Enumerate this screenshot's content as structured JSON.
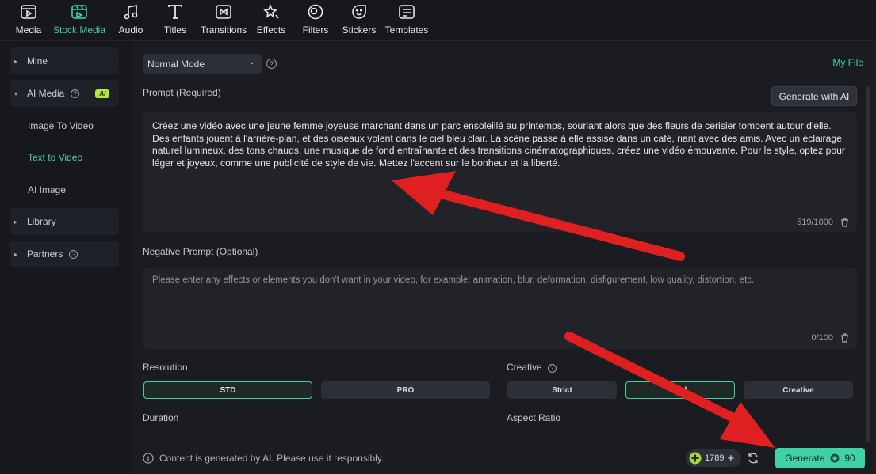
{
  "toolbar": {
    "items": [
      {
        "label": "Media",
        "icon": "media-icon"
      },
      {
        "label": "Stock Media",
        "icon": "stock-media-icon",
        "active": true
      },
      {
        "label": "Audio",
        "icon": "music-note-icon"
      },
      {
        "label": "Titles",
        "icon": "text-t-icon"
      },
      {
        "label": "Transitions",
        "icon": "transitions-icon"
      },
      {
        "label": "Effects",
        "icon": "effects-icon"
      },
      {
        "label": "Filters",
        "icon": "filters-icon"
      },
      {
        "label": "Stickers",
        "icon": "stickers-icon"
      },
      {
        "label": "Templates",
        "icon": "templates-icon"
      }
    ]
  },
  "sidebar": {
    "mine": "Mine",
    "ai_media": "AI Media",
    "ai_badge": "AI",
    "sub_items": [
      "Image To Video",
      "Text to Video",
      "AI Image"
    ],
    "active_sub": "Text to Video",
    "library": "Library",
    "partners": "Partners"
  },
  "main": {
    "mode": "Normal Mode",
    "my_file": "My File",
    "prompt_label": "Prompt (Required)",
    "generate_with_ai": "Generate with AI",
    "prompt_text": "Créez une vidéo avec une jeune femme joyeuse marchant dans un parc ensoleillé au printemps, souriant alors que des fleurs de cerisier tombent autour d'elle. Des enfants jouent à l'arrière-plan, et des oiseaux volent dans le ciel bleu clair. La scène passe à elle assise dans un café, riant avec des amis. Avec un éclairage naturel lumineux, des tons chauds, une musique de fond entraînante et des transitions cinématographiques, créez une vidéo émouvante. Pour le style, optez pour léger et joyeux, comme une publicité de style de vie. Mettez l'accent sur le bonheur et la liberté.",
    "prompt_counter": "519/1000",
    "negative_label": "Negative Prompt (Optional)",
    "negative_placeholder": "Please enter any effects or elements you don't want in your video, for example: animation, blur, deformation, disfigurement, low quality, distortion, etc.",
    "negative_counter": "0/100",
    "resolution_label": "Resolution",
    "resolution_options": [
      "STD",
      "PRO"
    ],
    "resolution_selected": "STD",
    "creative_label": "Creative",
    "creative_options": [
      "Strict",
      "...al",
      "Creative"
    ],
    "creative_selected": "...al",
    "duration_label": "Duration",
    "aspect_label": "Aspect Ratio",
    "notice": "Content is generated by AI. Please use it responsibly.",
    "credits": "1789",
    "generate_label": "Generate",
    "generate_cost": "90"
  },
  "colors": {
    "accent": "#3fd2a6",
    "annotation_arrow": "#e02020",
    "ai_badge": "#b8e834"
  }
}
